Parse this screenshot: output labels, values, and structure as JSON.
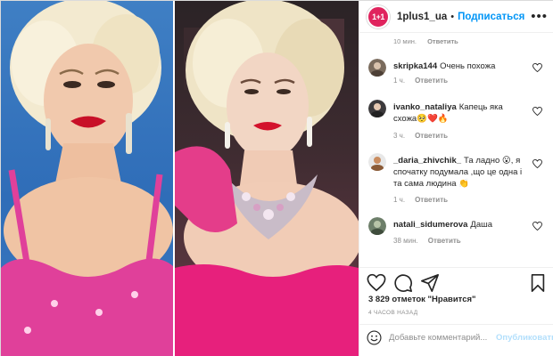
{
  "header": {
    "username": "1plus1_ua",
    "avatar_text": "1+1",
    "follow_label": "Подписаться",
    "separator": "•",
    "more_icon": "more-horizontal-icon"
  },
  "clipped_meta": {
    "time": "10 мин.",
    "reply": "Ответить"
  },
  "comments": [
    {
      "user": "skripka144",
      "text": "Очень похожа",
      "time": "1 ч.",
      "reply": "Ответить"
    },
    {
      "user": "ivanko_nataliya",
      "text": "Капець яка схожа🥺❤️🔥",
      "time": "3 ч.",
      "reply": "Ответить"
    },
    {
      "user": "_daria_zhivchik_",
      "text": "Та ладно 😮, я спочатку подумала ,що це одна і та сама людина 👏",
      "time": "1 ч.",
      "reply": "Ответить"
    },
    {
      "user": "natali_sidumerova",
      "text": "Даша",
      "time": "38 мин.",
      "reply": "Ответить"
    }
  ],
  "actions": {
    "likes": "3 829 отметок \"Нравится\"",
    "timestamp": "4 ЧАСОВ НАЗАД"
  },
  "add_comment": {
    "placeholder": "Добавьте комментарий...",
    "publish_label": "Опубликовать"
  },
  "colors": {
    "accent": "#0095f6",
    "brand": "#e0245e",
    "publish_disabled": "#b2dffc",
    "muted": "#8e8e8e"
  }
}
